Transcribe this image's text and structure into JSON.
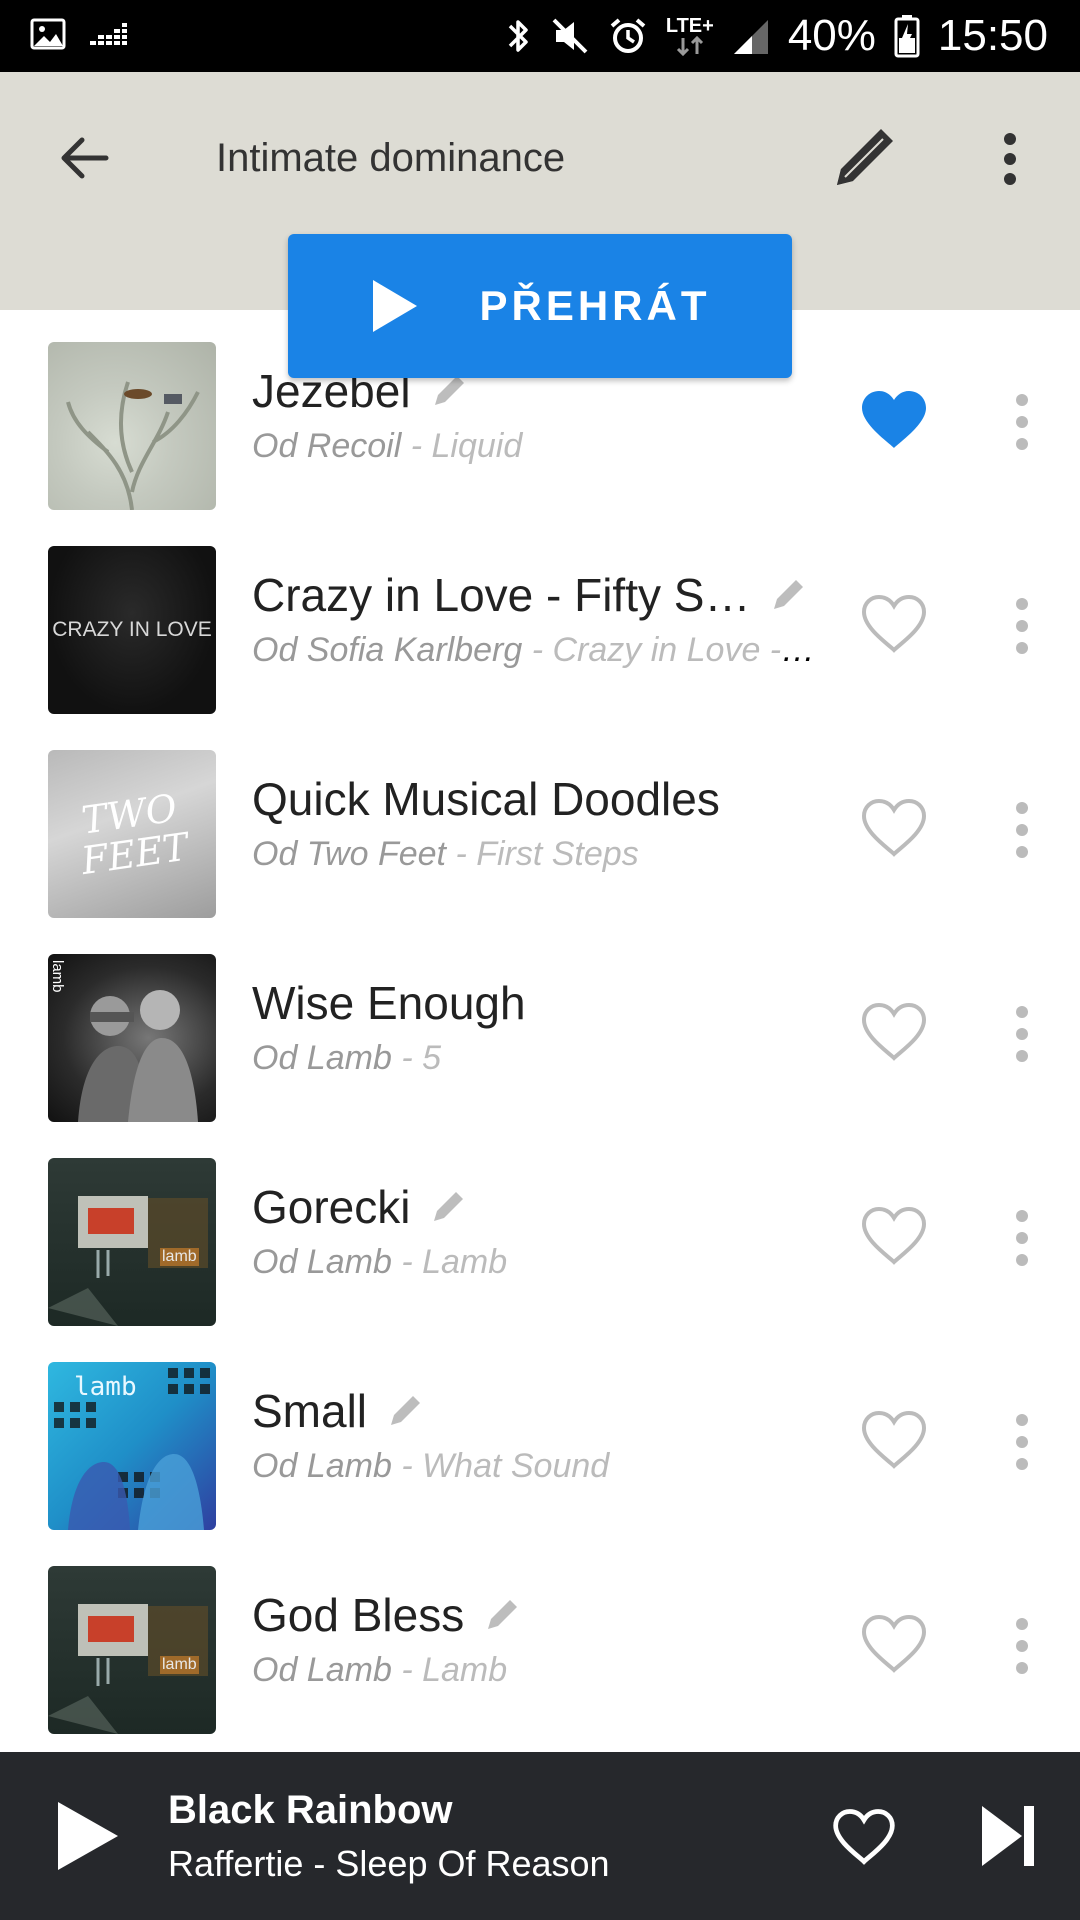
{
  "status_bar": {
    "battery": "40%",
    "time": "15:50",
    "network": "LTE+",
    "icons": [
      "image-icon",
      "equalizer-icon",
      "bluetooth-icon",
      "mute-icon",
      "alarm-icon",
      "signal-icon",
      "battery-icon"
    ]
  },
  "toolbar": {
    "title": "Intimate dominance",
    "back_icon": "arrow-left-icon",
    "edit_icon": "pencil-icon",
    "menu_icon": "more-vert-icon",
    "play_label": "PŘEHRÁT"
  },
  "tracks": [
    {
      "title": "Jezebel",
      "artist": "Od Recoil",
      "album": "- Liquid",
      "liked": true,
      "has_lyrics": true
    },
    {
      "title": "Crazy in Love - Fifty S…",
      "artist": "Od Sofia Karlberg",
      "album": "- Crazy in Love - …",
      "liked": false,
      "has_lyrics": true,
      "art_text": "CRAZY IN LOVE"
    },
    {
      "title": "Quick Musical Doodles",
      "artist": "Od Two Feet",
      "album": "- First Steps",
      "liked": false,
      "has_lyrics": false,
      "art_text": "TWO FEET"
    },
    {
      "title": "Wise Enough",
      "artist": "Od Lamb",
      "album": "- 5",
      "liked": false,
      "has_lyrics": false,
      "art_text": "lamb"
    },
    {
      "title": "Gorecki",
      "artist": "Od Lamb",
      "album": "- Lamb",
      "liked": false,
      "has_lyrics": true,
      "art_text": "lamb"
    },
    {
      "title": "Small",
      "artist": "Od Lamb",
      "album": "- What Sound",
      "liked": false,
      "has_lyrics": true,
      "art_text": "lamb"
    },
    {
      "title": "God Bless",
      "artist": "Od Lamb",
      "album": "- Lamb",
      "liked": false,
      "has_lyrics": true,
      "art_text": "lamb"
    }
  ],
  "player": {
    "title": "Black Rainbow",
    "subtitle": "Raffertie - Sleep Of Reason"
  },
  "colors": {
    "accent": "#1a83e6",
    "toolbar_bg": "#dddcd4",
    "player_bg": "#26282c"
  }
}
